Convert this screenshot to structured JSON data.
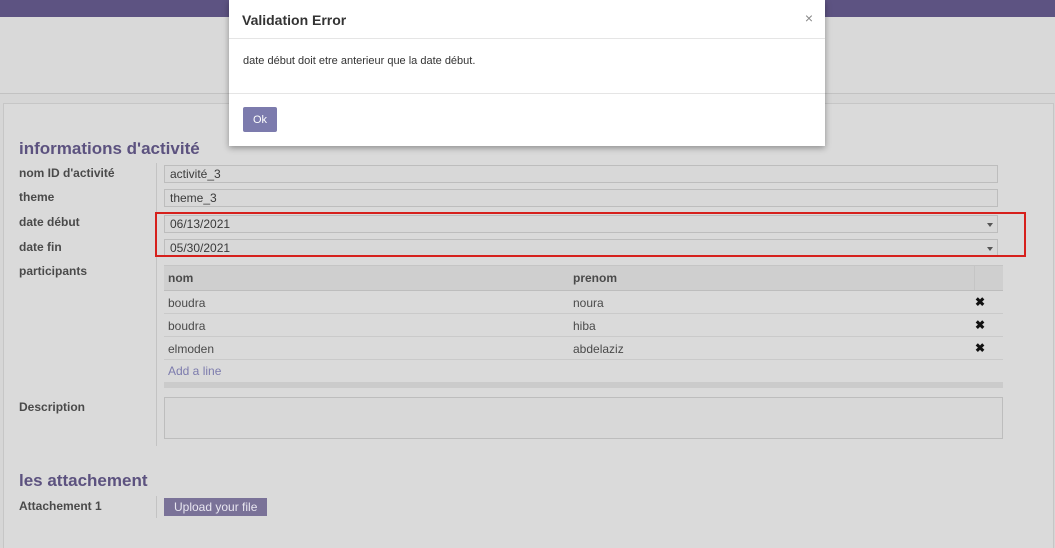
{
  "modal": {
    "title": "Validation Error",
    "close_glyph": "×",
    "message": "date début doit etre anterieur que la date début.",
    "ok_label": "Ok"
  },
  "form": {
    "section1_title": "informations d'activité",
    "fields": {
      "nom_label": "nom ID d'activité",
      "nom_value": "activité_3",
      "theme_label": "theme",
      "theme_value": "theme_3",
      "date_debut_label": "date début",
      "date_debut_value": "06/13/2021",
      "date_fin_label": "date fin",
      "date_fin_value": "05/30/2021",
      "participants_label": "participants",
      "description_label": "Description"
    },
    "participants": {
      "columns": [
        "nom",
        "prenom"
      ],
      "rows": [
        {
          "nom": "boudra",
          "prenom": "noura"
        },
        {
          "nom": "boudra",
          "prenom": "hiba"
        },
        {
          "nom": "elmoden",
          "prenom": "abdelaziz"
        }
      ],
      "add_line": "Add a line",
      "delete_glyph": "✖"
    },
    "section2_title": "les attachement",
    "attachment_label": "Attachement 1",
    "upload_label": "Upload your file"
  },
  "colors": {
    "brand": "#7c7bad",
    "highlight": "#d6201c"
  }
}
